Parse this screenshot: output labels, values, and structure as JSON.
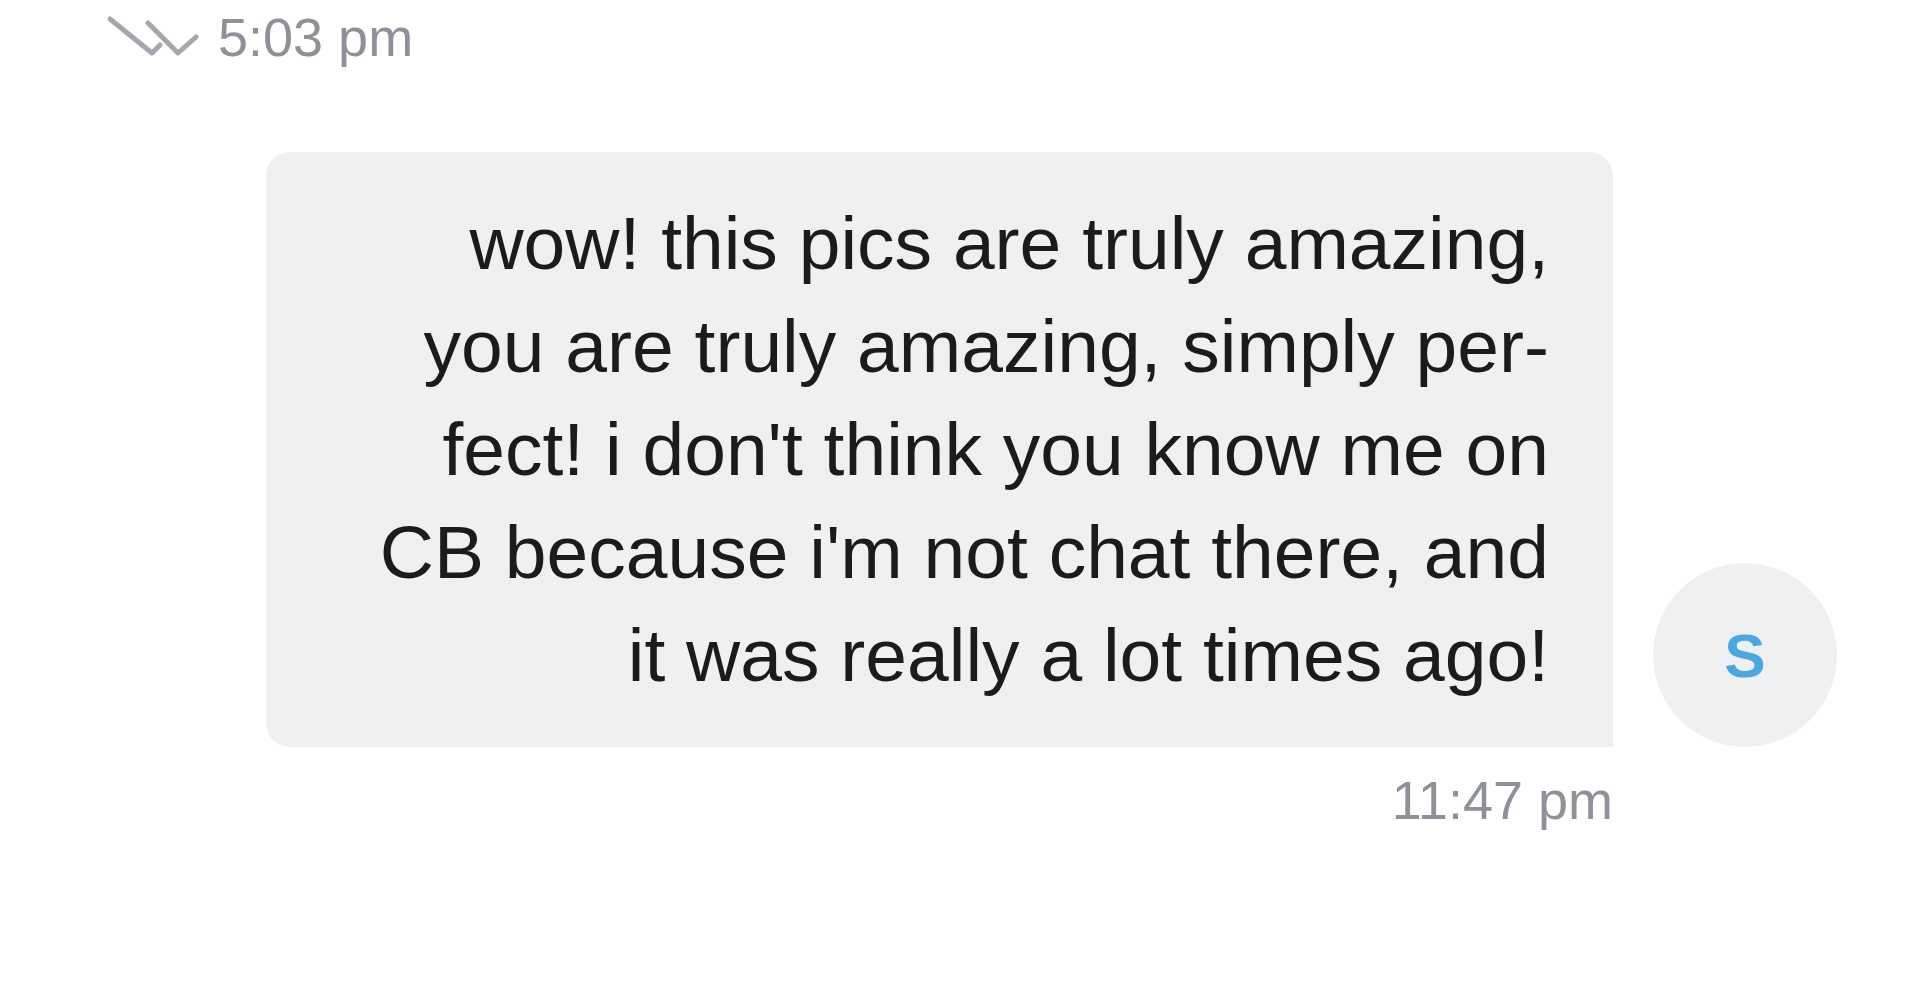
{
  "header": {
    "time": "5:03 pm",
    "read": true
  },
  "message": {
    "sender_initial": "S",
    "text": "wow! this pics are truly amazing,\nyou are truly amazing, simply per-\nfect! i don't think you know me on\nCB because i'm not chat there, and\nit was really a lot times ago!",
    "time": "11:47 pm"
  }
}
